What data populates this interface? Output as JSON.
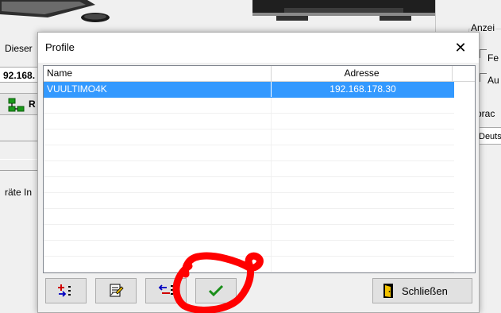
{
  "background": {
    "label_dieser": "Dieser",
    "ip_fragment": "92.168.",
    "button_fragment": "R",
    "label_geraete": "räte In",
    "group_anzeige": "Anzei",
    "option_fe": "Fe",
    "option_au": "Au",
    "label_sprache": "prac",
    "select_value": "Deuts"
  },
  "dialog": {
    "title": "Profile",
    "close_glyph": "✕",
    "columns": {
      "name": "Name",
      "address": "Adresse"
    },
    "rows": [
      {
        "name": "VUULTIMO4K",
        "address": "192.168.178.30",
        "selected": true
      }
    ],
    "close_button_label": "Schließen"
  },
  "icons": [
    "add-profile-icon",
    "edit-profile-icon",
    "import-profile-icon",
    "checkmark-icon",
    "exit-door-icon",
    "close-icon"
  ],
  "colors": {
    "selection": "#3399ff",
    "annotation": "#ff0000",
    "check": "#1a8f1a"
  }
}
